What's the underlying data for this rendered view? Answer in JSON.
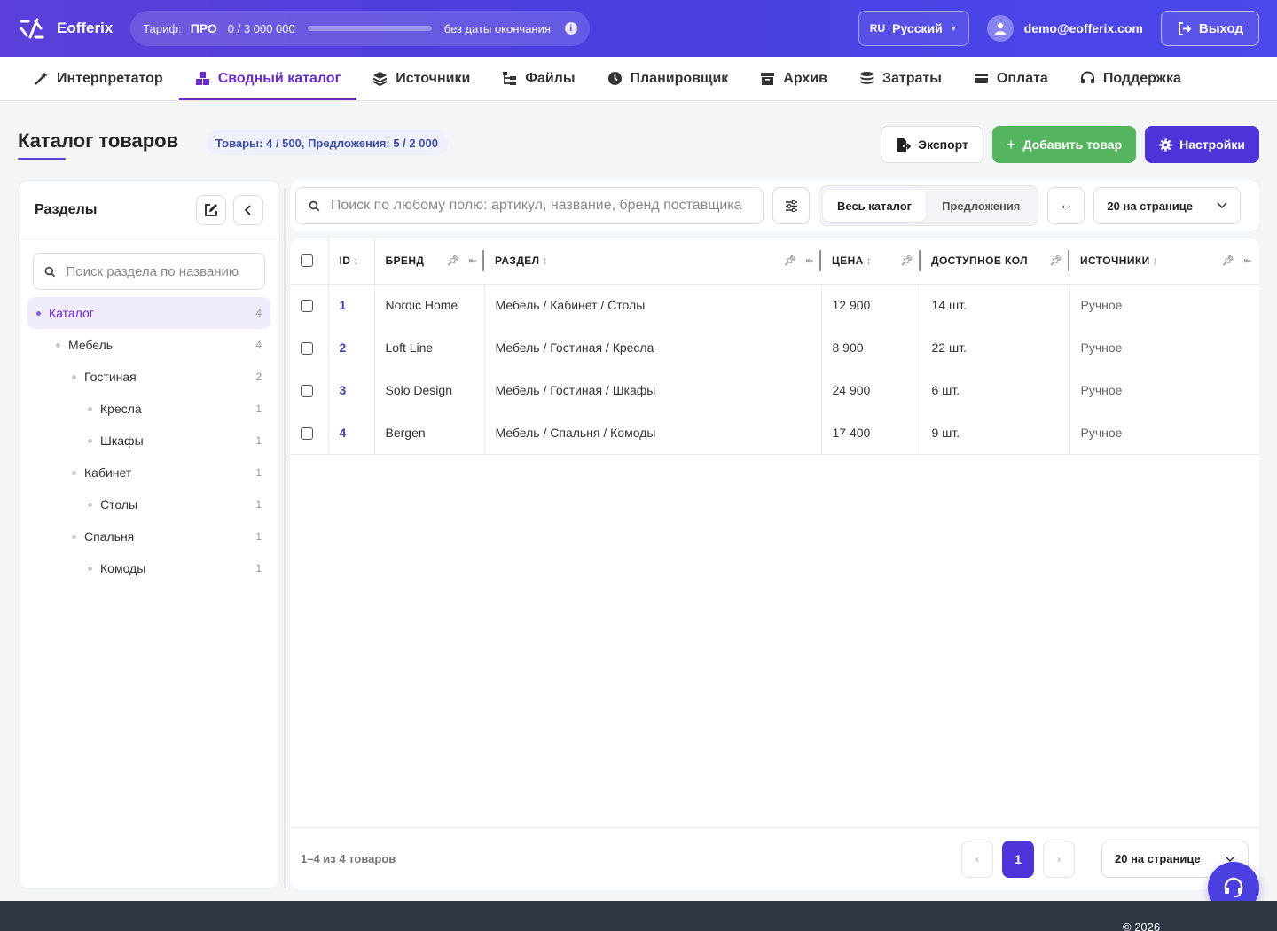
{
  "header": {
    "brand": "Eofferix",
    "tariff_label": "Тариф:",
    "tariff_plan": "ПРО",
    "tariff_usage": "0 / 3 000 000",
    "tariff_usage_fraction": 0.0,
    "tariff_expiry": "без даты окончания",
    "lang_code": "RU",
    "lang_name": "Русский",
    "user_email": "demo@eofferix.com",
    "logout_label": "Выход"
  },
  "nav": {
    "items": [
      {
        "label": "Интерпретатор",
        "icon": "magic-wand-icon"
      },
      {
        "label": "Сводный каталог",
        "icon": "boxes-icon",
        "active": true
      },
      {
        "label": "Источники",
        "icon": "layers-icon"
      },
      {
        "label": "Файлы",
        "icon": "folder-tree-icon"
      },
      {
        "label": "Планировщик",
        "icon": "clock-icon"
      },
      {
        "label": "Архив",
        "icon": "archive-icon"
      },
      {
        "label": "Затраты",
        "icon": "coins-icon"
      },
      {
        "label": "Оплата",
        "icon": "credit-card-icon"
      },
      {
        "label": "Поддержка",
        "icon": "headset-icon"
      }
    ]
  },
  "page": {
    "title": "Каталог товаров",
    "stats": "Товары: 4 / 500, Предложения: 5 / 2 000",
    "export_label": "Экспорт",
    "add_label": "Добавить товар",
    "settings_label": "Настройки"
  },
  "sidebar": {
    "title": "Разделы",
    "search_placeholder": "Поиск раздела по названию",
    "tree": [
      {
        "label": "Каталог",
        "count": "4",
        "level": 0,
        "active": true
      },
      {
        "label": "Мебель",
        "count": "4",
        "level": 1
      },
      {
        "label": "Гостиная",
        "count": "2",
        "level": 2
      },
      {
        "label": "Кресла",
        "count": "1",
        "level": 3
      },
      {
        "label": "Шкафы",
        "count": "1",
        "level": 3
      },
      {
        "label": "Кабинет",
        "count": "1",
        "level": 2
      },
      {
        "label": "Столы",
        "count": "1",
        "level": 3
      },
      {
        "label": "Спальня",
        "count": "1",
        "level": 2
      },
      {
        "label": "Комоды",
        "count": "1",
        "level": 3
      }
    ]
  },
  "toolbar": {
    "search_placeholder": "Поиск по любому полю: артикул, название, бренд поставщика",
    "seg_all": "Весь каталог",
    "seg_offers": "Предложения",
    "per_page": "20 на странице"
  },
  "table": {
    "columns": {
      "id": "ID",
      "brand": "БРЕНД",
      "section": "РАЗДЕЛ",
      "price": "ЦЕНА",
      "qty": "ДОСТУПНОЕ КОЛ",
      "sources": "ИСТОЧНИКИ"
    },
    "rows": [
      {
        "id": "1",
        "brand": "Nordic Home",
        "section": "Мебель / Кабинет / Столы",
        "price": "12 900",
        "qty": "14 шт.",
        "sources": "Ручное"
      },
      {
        "id": "2",
        "brand": "Loft Line",
        "section": "Мебель / Гостиная / Кресла",
        "price": "8 900",
        "qty": "22 шт.",
        "sources": "Ручное"
      },
      {
        "id": "3",
        "brand": "Solo Design",
        "section": "Мебель / Гостиная / Шкафы",
        "price": "24 900",
        "qty": "6 шт.",
        "sources": "Ручное"
      },
      {
        "id": "4",
        "brand": "Bergen",
        "section": "Мебель / Спальня / Комоды",
        "price": "17 400",
        "qty": "9 шт.",
        "sources": "Ручное"
      }
    ],
    "range_text": "1–4 из 4 товаров",
    "current_page": "1",
    "prev": "‹",
    "next": "›",
    "per_page": "20 на странице"
  },
  "footer": {
    "copyright": "© 2026"
  }
}
